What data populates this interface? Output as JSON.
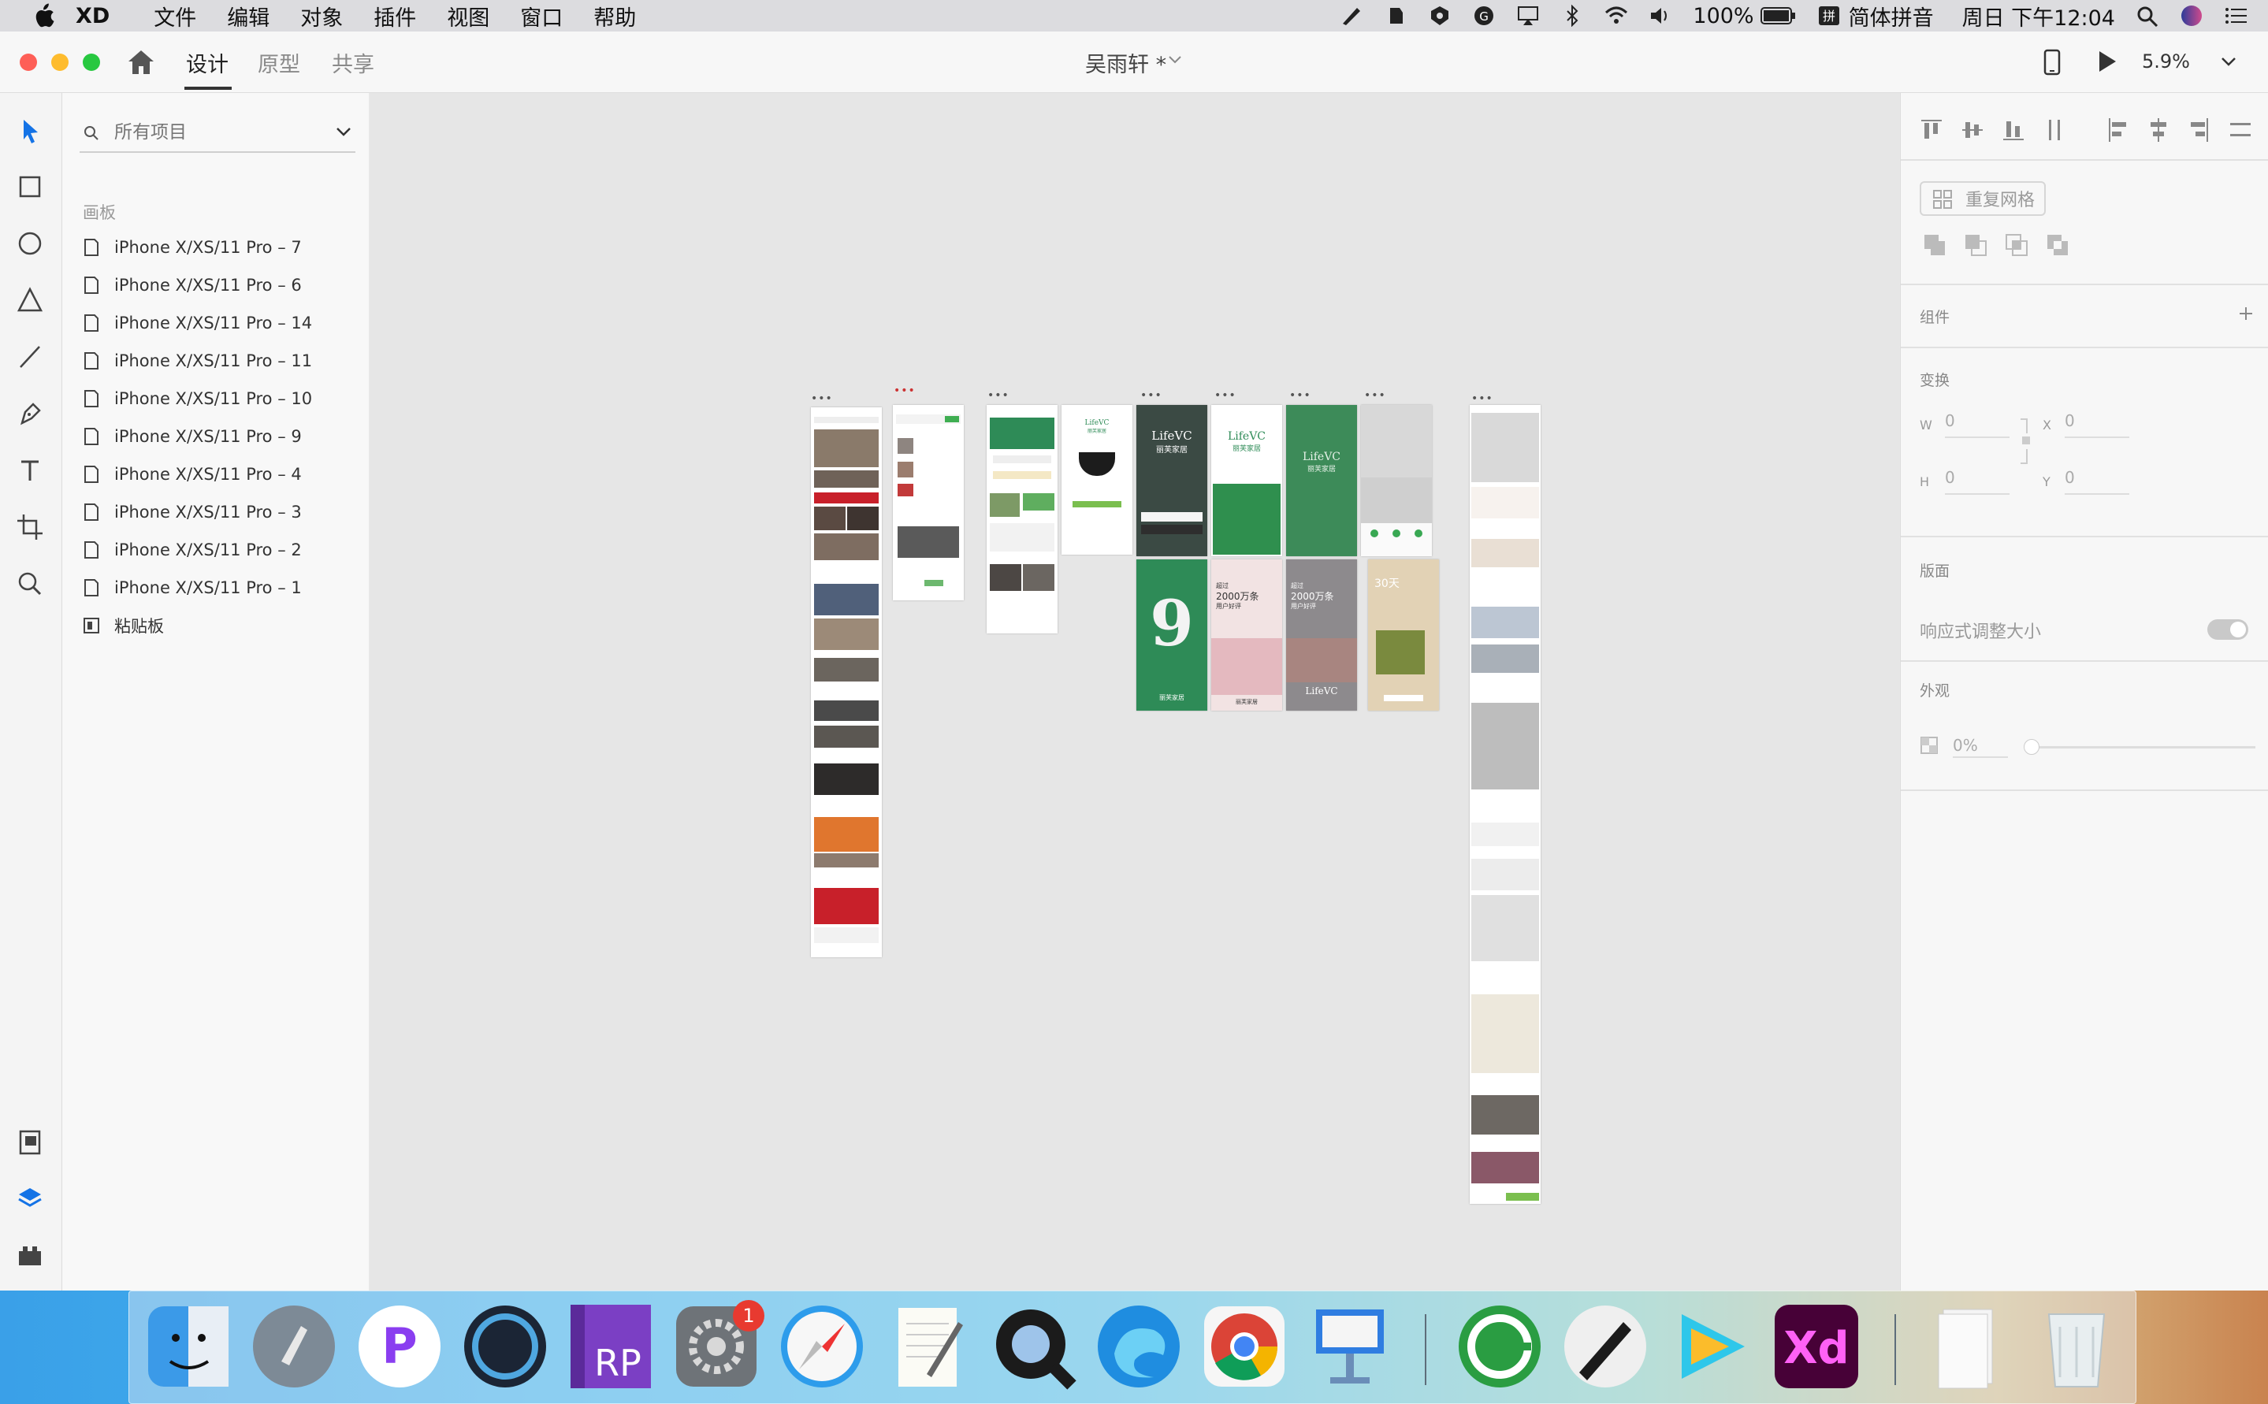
{
  "menubar": {
    "app": "XD",
    "items": [
      "文件",
      "编辑",
      "对象",
      "插件",
      "视图",
      "窗口",
      "帮助"
    ],
    "battery": "100%",
    "input_method": "简体拼音",
    "clock": "周日 下午12:04"
  },
  "titlebar": {
    "tabs": [
      "设计",
      "原型",
      "共享"
    ],
    "active_tab": "设计",
    "document": "吴雨轩 *",
    "zoom": "5.9%"
  },
  "layers": {
    "search_placeholder": "所有项目",
    "section": "画板",
    "artboards": [
      "iPhone X/XS/11 Pro – 7",
      "iPhone X/XS/11 Pro – 6",
      "iPhone X/XS/11 Pro – 14",
      "iPhone X/XS/11 Pro – 11",
      "iPhone X/XS/11 Pro – 10",
      "iPhone X/XS/11 Pro – 9",
      "iPhone X/XS/11 Pro – 4",
      "iPhone X/XS/11 Pro – 3",
      "iPhone X/XS/11 Pro – 2",
      "iPhone X/XS/11 Pro – 1"
    ],
    "pasteboard": "粘贴板"
  },
  "canvas": {
    "artboard_dots": "•••",
    "brand_en": "LifeVC",
    "brand_cn": "丽芙家居",
    "promo_line1": "超过",
    "promo_line2": "2000万条",
    "promo_line3": "用户好评",
    "promo_days": "30天",
    "big_number": "9",
    "accent_green": "#2e8b57",
    "accent_red": "#c8202a"
  },
  "props": {
    "repeat_grid": "重复网格",
    "components": "组件",
    "transform": "变换",
    "w_label": "W",
    "w_value": "0",
    "h_label": "H",
    "h_value": "0",
    "x_label": "X",
    "x_value": "0",
    "y_label": "Y",
    "y_value": "0",
    "layout": "版面",
    "responsive": "响应式调整大小",
    "appearance": "外观",
    "opacity": "0%"
  },
  "dock": {
    "apps": [
      "Finder",
      "Launchpad",
      "PicGo",
      "Cinema 4D",
      "Axure RP",
      "System Preferences",
      "Safari",
      "TextEdit",
      "QuickTime",
      "Edge",
      "Chrome",
      "Keynote",
      "CleanMyMac",
      "Pen",
      "Tencent Video",
      "Adobe XD",
      "Documents",
      "Trash"
    ],
    "sysprefs_badge": "1",
    "rp_label": "RP",
    "xd_label": "Xd"
  }
}
